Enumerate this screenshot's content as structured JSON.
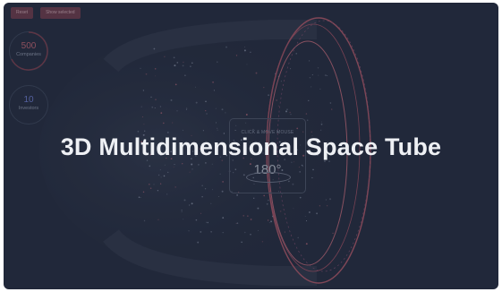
{
  "title": "3D Multidimensional Space Tube",
  "toolbar": {
    "reset_label": "Reset",
    "second_label": "Show selected"
  },
  "stats": {
    "companies": {
      "value": "500",
      "label": "Companies"
    },
    "investors": {
      "value": "10",
      "label": "Investors"
    }
  },
  "control": {
    "hint": "CLICK & MOVE MOUSE",
    "angle": "180°"
  },
  "colors": {
    "background": "#232a3d",
    "accent_red": "#b8606e",
    "accent_blue": "#6a78c8",
    "button": "#6a3a4a"
  },
  "icons": [
    "rotation-control-ring",
    "space-tube-visualization"
  ]
}
